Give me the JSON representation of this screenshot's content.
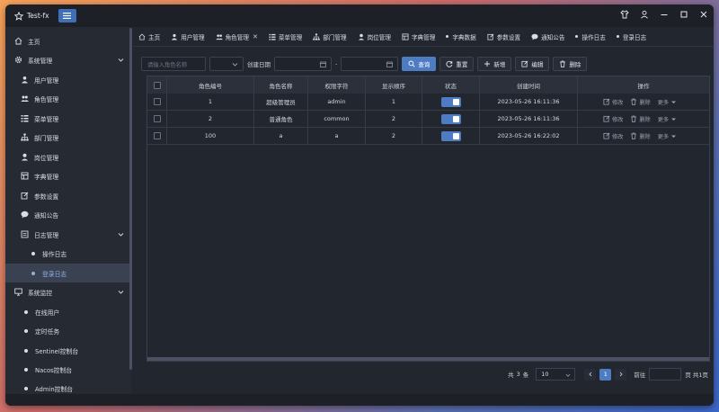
{
  "window": {
    "title": "Test-fx"
  },
  "sidebar": {
    "items": [
      {
        "label": "主页",
        "icon": "home-icon"
      },
      {
        "label": "系统管理",
        "icon": "gear-icon"
      },
      {
        "label": "用户管理",
        "icon": "user-icon"
      },
      {
        "label": "角色管理",
        "icon": "users-icon"
      },
      {
        "label": "菜单管理",
        "icon": "list-icon"
      },
      {
        "label": "部门管理",
        "icon": "org-icon"
      },
      {
        "label": "岗位管理",
        "icon": "post-icon"
      },
      {
        "label": "字典管理",
        "icon": "dict-icon"
      },
      {
        "label": "参数设置",
        "icon": "edit-icon"
      },
      {
        "label": "通知公告",
        "icon": "chat-icon"
      },
      {
        "label": "日志管理",
        "icon": "log-icon"
      },
      {
        "label": "操作日志",
        "icon": "dot"
      },
      {
        "label": "登录日志",
        "icon": "dot"
      },
      {
        "label": "系统监控",
        "icon": "monitor-icon"
      },
      {
        "label": "在线用户",
        "icon": "dot"
      },
      {
        "label": "定时任务",
        "icon": "dot"
      },
      {
        "label": "Sentinel控制台",
        "icon": "dot"
      },
      {
        "label": "Nacos控制台",
        "icon": "dot"
      },
      {
        "label": "Admin控制台",
        "icon": "dot"
      }
    ]
  },
  "tabs": [
    {
      "label": "主页"
    },
    {
      "label": "用户管理"
    },
    {
      "label": "角色管理",
      "close": "✕"
    },
    {
      "label": "菜单管理"
    },
    {
      "label": "部门管理"
    },
    {
      "label": "岗位管理"
    },
    {
      "label": "字典管理"
    },
    {
      "label": "字典数据"
    },
    {
      "label": "参数设置"
    },
    {
      "label": "通知公告"
    },
    {
      "label": "操作日志"
    },
    {
      "label": "登录日志"
    }
  ],
  "toolbar": {
    "role_name_placeholder": "请输入角色名称",
    "created_label": "创建日期",
    "date_separator": "-",
    "query": "查询",
    "reset": "重置",
    "add": "新增",
    "edit": "编辑",
    "delete": "删除"
  },
  "table": {
    "columns": [
      "角色编号",
      "角色名称",
      "权限字符",
      "显示顺序",
      "状态",
      "创建时间",
      "操作"
    ],
    "rows": [
      {
        "id": "1",
        "name": "超级管理员",
        "key": "admin",
        "order": "1",
        "created": "2023-05-26 16:11:36"
      },
      {
        "id": "2",
        "name": "普通角色",
        "key": "common",
        "order": "2",
        "created": "2023-05-26 16:11:36"
      },
      {
        "id": "100",
        "name": "a",
        "key": "a",
        "order": "2",
        "created": "2023-05-26 16:22:02"
      }
    ],
    "ops": {
      "edit": "修改",
      "delete": "删除",
      "more": "更多"
    }
  },
  "pager": {
    "total_prefix": "共",
    "total": "3",
    "total_suffix": "条",
    "page_size": "10",
    "current_page": "1",
    "goto_label": "前往",
    "pages_label": "页 共1页"
  },
  "colors": {
    "accent": "#4e7cc2",
    "bg": "#22262f",
    "sidebar": "#262a33"
  }
}
